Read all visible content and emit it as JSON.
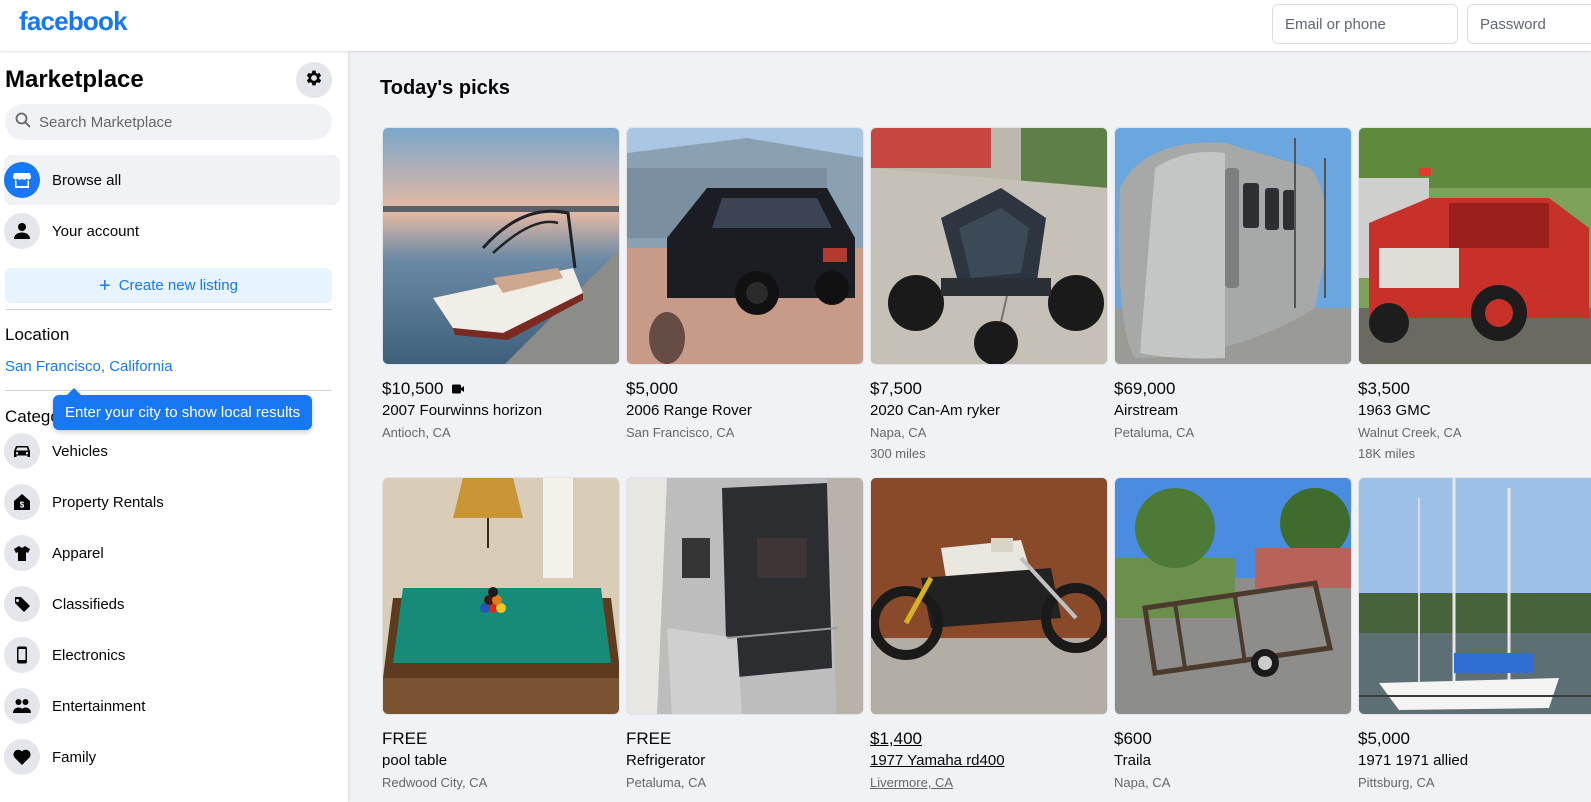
{
  "header": {
    "logo": "facebook",
    "email_placeholder": "Email or phone",
    "password_placeholder": "Password"
  },
  "sidebar": {
    "title": "Marketplace",
    "settings_icon": "gear-icon",
    "search_placeholder": "Search Marketplace",
    "nav": [
      {
        "label": "Browse all",
        "icon": "storefront-icon",
        "active": true
      },
      {
        "label": "Your account",
        "icon": "person-icon",
        "active": false
      }
    ],
    "create_listing": "Create new listing",
    "location_heading": "Location",
    "location_value": "San Francisco, California",
    "tooltip": "Enter your city to show local results",
    "categories_heading": "Categories",
    "categories": [
      {
        "label": "Vehicles",
        "icon": "car-icon"
      },
      {
        "label": "Property Rentals",
        "icon": "house-dollar-icon"
      },
      {
        "label": "Apparel",
        "icon": "shirt-icon"
      },
      {
        "label": "Classifieds",
        "icon": "tag-icon"
      },
      {
        "label": "Electronics",
        "icon": "phone-icon"
      },
      {
        "label": "Entertainment",
        "icon": "people-icon"
      },
      {
        "label": "Family",
        "icon": "heart-icon"
      }
    ]
  },
  "main": {
    "title": "Today's picks",
    "listings": [
      {
        "price": "$10,500",
        "title": "2007 Fourwinns horizon",
        "location": "Antioch, CA",
        "extra": "",
        "video": true,
        "image": "boat"
      },
      {
        "price": "$5,000",
        "title": "2006 Range Rover",
        "location": "San Francisco, CA",
        "extra": "",
        "video": false,
        "image": "suv"
      },
      {
        "price": "$7,500",
        "title": "2020 Can-Am ryker",
        "location": "Napa, CA",
        "extra": "300 miles",
        "video": false,
        "image": "trike"
      },
      {
        "price": "$69,000",
        "title": "Airstream",
        "location": "Petaluma, CA",
        "extra": "",
        "video": false,
        "image": "airstream"
      },
      {
        "price": "$3,500",
        "title": "1963 GMC",
        "location": "Walnut Creek, CA",
        "extra": "18K miles",
        "video": false,
        "image": "firetruck"
      },
      {
        "price": "FREE",
        "title": "pool table",
        "location": "Redwood City, CA",
        "extra": "",
        "video": false,
        "image": "pooltable"
      },
      {
        "price": "FREE",
        "title": "Refrigerator",
        "location": "Petaluma, CA",
        "extra": "",
        "video": false,
        "image": "fridge"
      },
      {
        "price": "$1,400",
        "title": "1977 Yamaha rd400",
        "location": "Livermore, CA",
        "extra": "",
        "video": false,
        "image": "motorcycle",
        "underlined": true
      },
      {
        "price": "$600",
        "title": "Traila",
        "location": "Napa, CA",
        "extra": "",
        "video": false,
        "image": "trailer"
      },
      {
        "price": "$5,000",
        "title": "1971 1971 allied",
        "location": "Pittsburg, CA",
        "extra": "",
        "video": false,
        "image": "sailboat"
      }
    ]
  },
  "colors": {
    "brand": "#1877f2",
    "background": "#f0f2f5",
    "secondary_text": "#65676b"
  }
}
